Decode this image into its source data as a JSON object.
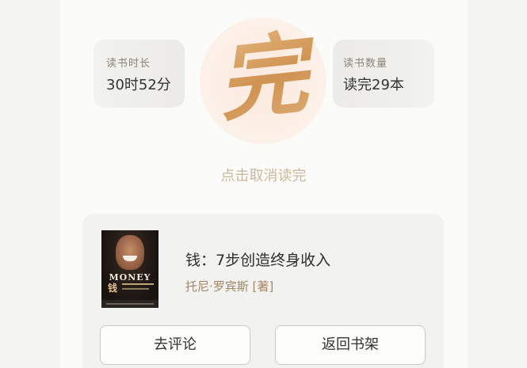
{
  "stats": {
    "reading_time_label": "读书时长",
    "reading_time_value": "30时52分",
    "book_count_label": "读书数量",
    "book_count_value": "读完29本"
  },
  "badge": {
    "char": "完"
  },
  "cancel_label": "点击取消读完",
  "book": {
    "cover_title": "MONEY",
    "cover_cn": "钱",
    "title": "钱：7步创造终身收入",
    "author": "托尼·罗宾斯 [著]"
  },
  "actions": {
    "review_label": "去评论",
    "back_label": "返回书架"
  }
}
